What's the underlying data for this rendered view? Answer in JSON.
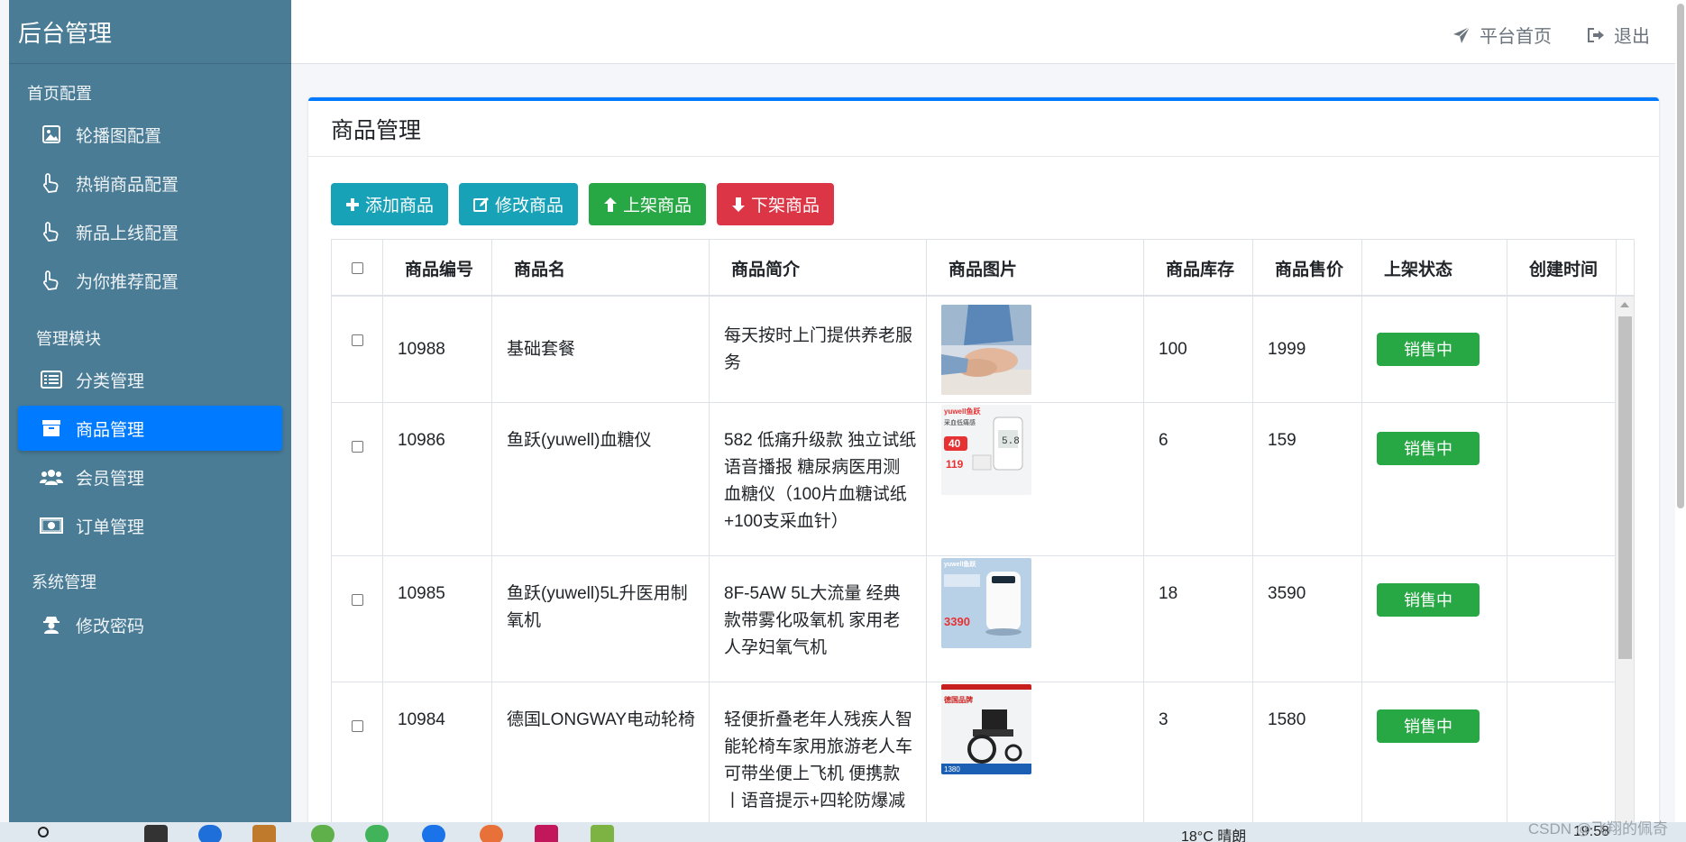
{
  "sidebar": {
    "brand": "后台管理",
    "groups": [
      {
        "title": "首页配置",
        "items": [
          {
            "label": "轮播图配置",
            "icon": "image-icon"
          },
          {
            "label": "热销商品配置",
            "icon": "hand-pointer-icon"
          },
          {
            "label": "新品上线配置",
            "icon": "hand-pointer-icon"
          },
          {
            "label": "为你推荐配置",
            "icon": "hand-pointer-icon"
          }
        ]
      },
      {
        "title": "管理模块",
        "items": [
          {
            "label": "分类管理",
            "icon": "list-icon"
          },
          {
            "label": "商品管理",
            "icon": "archive-icon",
            "active": true
          },
          {
            "label": "会员管理",
            "icon": "users-icon"
          },
          {
            "label": "订单管理",
            "icon": "money-bill-icon"
          }
        ]
      },
      {
        "title": "系统管理",
        "items": [
          {
            "label": "修改密码",
            "icon": "user-secret-icon"
          }
        ]
      }
    ]
  },
  "topbar": {
    "home": "平台首页",
    "logout": "退出"
  },
  "card": {
    "title": "商品管理"
  },
  "toolbar": {
    "add": "添加商品",
    "edit": "修改商品",
    "up": "上架商品",
    "down": "下架商品"
  },
  "table": {
    "headers": [
      "商品编号",
      "商品名",
      "商品简介",
      "商品图片",
      "商品库存",
      "商品售价",
      "上架状态",
      "创建时间"
    ],
    "rows": [
      {
        "id": "10988",
        "name": "基础套餐",
        "desc": "每天按时上门提供养老服务",
        "stock": "100",
        "price": "1999",
        "status": "销售中",
        "created": ""
      },
      {
        "id": "10986",
        "name": "鱼跃(yuwell)血糖仪",
        "desc": "582 低痛升级款 独立试纸语音播报 糖尿病医用测血糖仪（100片血糖试纸+100支采血针）",
        "stock": "6",
        "price": "159",
        "status": "销售中",
        "created": ""
      },
      {
        "id": "10985",
        "name": "鱼跃(yuwell)5L升医用制氧机",
        "desc": "8F-5AW 5L大流量 经典款带雾化吸氧机 家用老人孕妇氧气机",
        "stock": "18",
        "price": "3590",
        "status": "销售中",
        "created": ""
      },
      {
        "id": "10984",
        "name": "德国LONGWAY电动轮椅",
        "desc": "轻便折叠老年人残疾人智能轮椅车家用旅游老人车可带坐便上飞机 便携款丨语音提示+四轮防爆减",
        "stock": "3",
        "price": "1580",
        "status": "销售中",
        "created": ""
      }
    ],
    "thumb_text": {
      "yuwell_brand": "yuwell鱼跃",
      "bgm_badge": "采血低痛感",
      "bgm_price1": "40",
      "bgm_price2": "119",
      "o2_price": "3390",
      "wc_brand": "德国品牌",
      "wc_price": "1380"
    }
  },
  "taskbar": {
    "weather": "18°C 晴朗",
    "time": "19:58",
    "watermark": "CSDN @飞翔的佩奇"
  }
}
